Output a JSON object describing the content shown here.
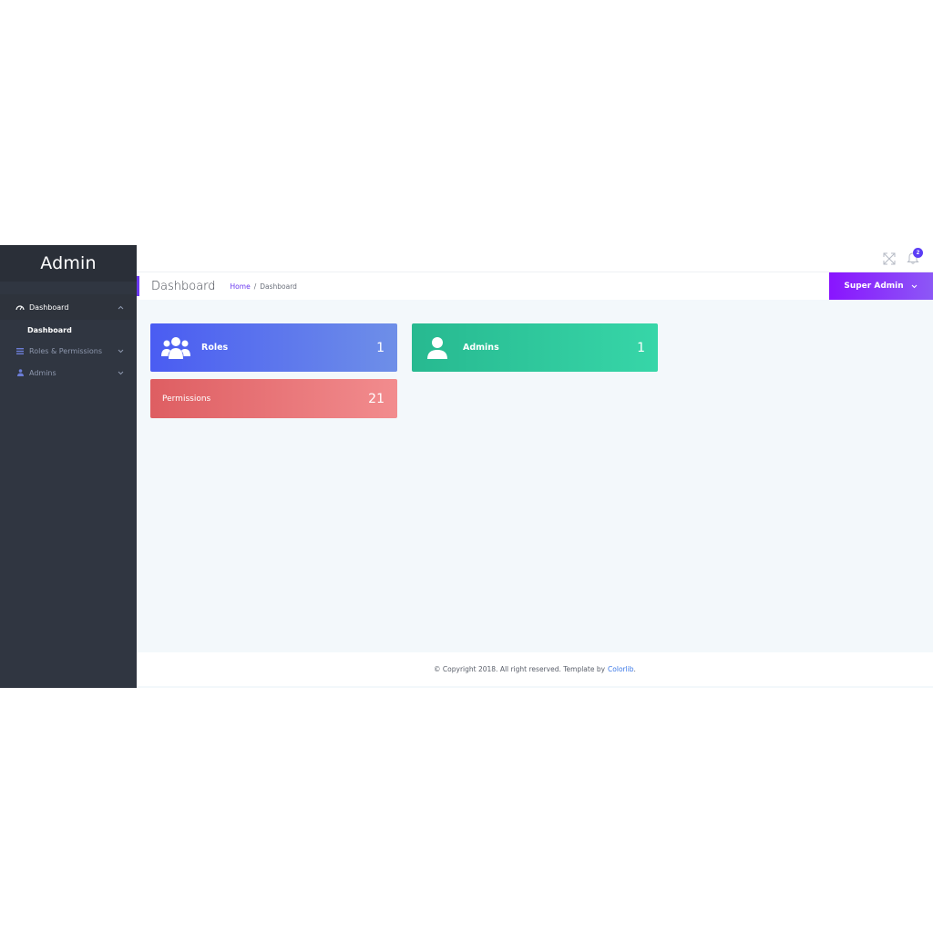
{
  "sidebar": {
    "brand": "Admin",
    "items": [
      {
        "label": "Dashboard",
        "icon": "dashboard-icon",
        "active": true
      },
      {
        "label": "Roles & Permissions",
        "icon": "tasks-icon"
      },
      {
        "label": "Admins",
        "icon": "user-icon"
      }
    ],
    "sub_items": [
      {
        "label": "Dashboard"
      }
    ]
  },
  "header": {
    "notification_count": "2",
    "page_title": "Dashboard",
    "breadcrumb": {
      "home": "Home",
      "separator": "/",
      "current": "Dashboard"
    },
    "user_name": "Super Admin"
  },
  "cards": {
    "roles": {
      "label": "Roles",
      "count": "1",
      "icon": "users-icon"
    },
    "admins": {
      "label": "Admins",
      "count": "1",
      "icon": "user-icon"
    },
    "permissions": {
      "label": "Permissions",
      "count": "21"
    }
  },
  "footer": {
    "text": "© Copyright 2018. All right reserved. Template by",
    "link": "Colorlib",
    "suffix": "."
  },
  "colors": {
    "sidebar_bg": "#303641",
    "accent": "#6a38f0",
    "roles_card": "#4a5cf2",
    "admins_card": "#27b990",
    "permissions_card": "#de5e62"
  }
}
